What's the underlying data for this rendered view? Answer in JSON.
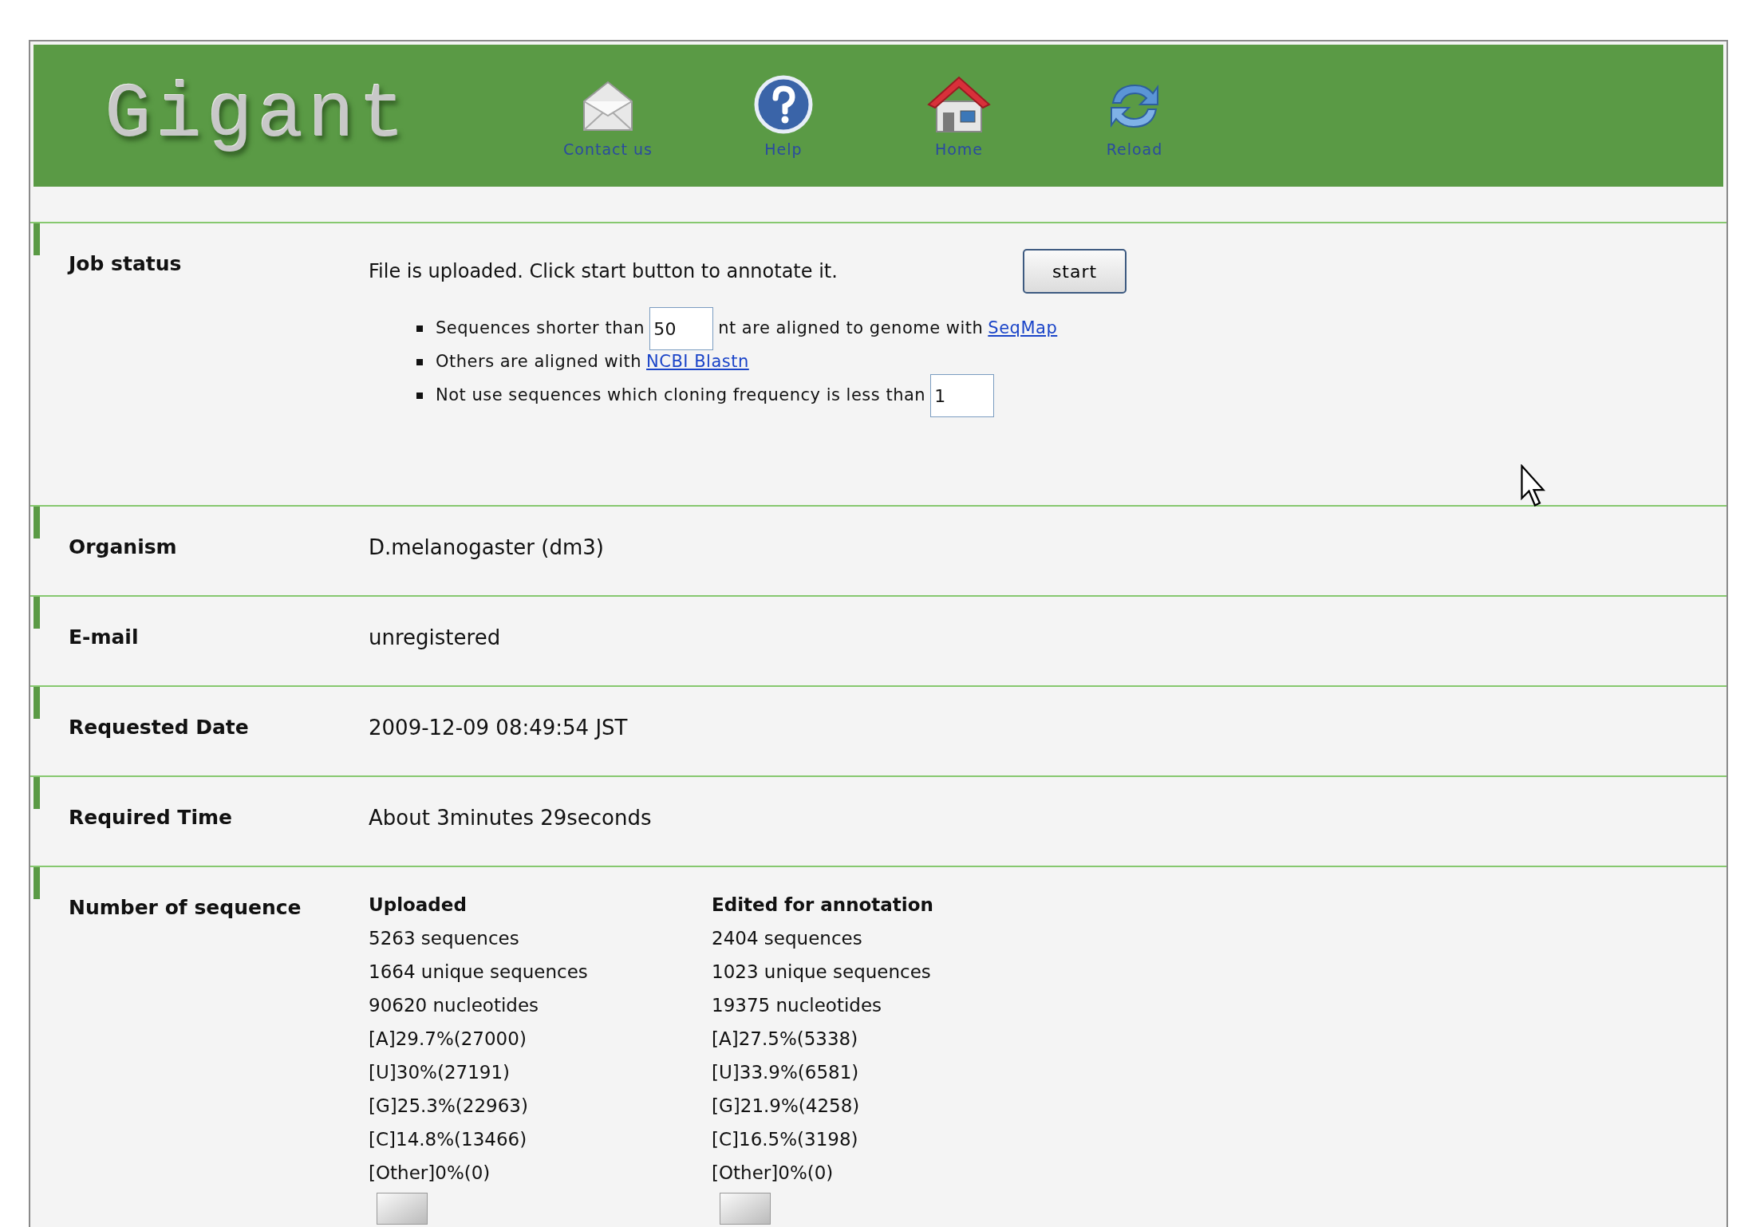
{
  "header": {
    "logo": "Gigant",
    "nav": [
      {
        "kind": "mail",
        "label": "Contact us"
      },
      {
        "kind": "help",
        "label": "Help"
      },
      {
        "kind": "home",
        "label": "Home"
      },
      {
        "kind": "reload",
        "label": "Reload"
      }
    ]
  },
  "job_status": {
    "label": "Job status",
    "message": "File is uploaded. Click start button to annotate it.",
    "button": "start",
    "options": [
      {
        "kind": "min_length",
        "before": "Sequences shorter than",
        "value": "50",
        "after": "nt are aligned to genome with",
        "link": "SeqMap"
      },
      {
        "kind": "link",
        "before": "Others are aligned with",
        "link": "NCBI Blastn"
      },
      {
        "kind": "min_freq",
        "before": "Not use sequences which cloning frequency is less than",
        "value": "1"
      }
    ]
  },
  "rows": [
    {
      "label": "Organism",
      "value": "D.melanogaster (dm3)"
    },
    {
      "label": "E-mail",
      "value": "unregistered"
    },
    {
      "label": "Requested Date",
      "value": "2009-12-09 08:49:54 JST"
    },
    {
      "label": "Required Time",
      "value": "About 3minutes 29seconds"
    }
  ],
  "sequences": {
    "label": "Number of sequence",
    "columns": [
      {
        "title": "Uploaded",
        "lines": [
          "5263 sequences",
          "1664 unique sequences",
          "90620 nucleotides",
          "[A]29.7%(27000)",
          "[U]30%(27191)",
          "[G]25.3%(22963)",
          "[C]14.8%(13466)",
          "[Other]0%(0)"
        ]
      },
      {
        "title": "Edited for annotation",
        "lines": [
          "2404 sequences",
          "1023 unique sequences",
          "19375 nucleotides",
          "[A]27.5%(5338)",
          "[U]33.9%(6581)",
          "[G]21.9%(4258)",
          "[C]16.5%(3198)",
          "[Other]0%(0)"
        ]
      }
    ]
  }
}
